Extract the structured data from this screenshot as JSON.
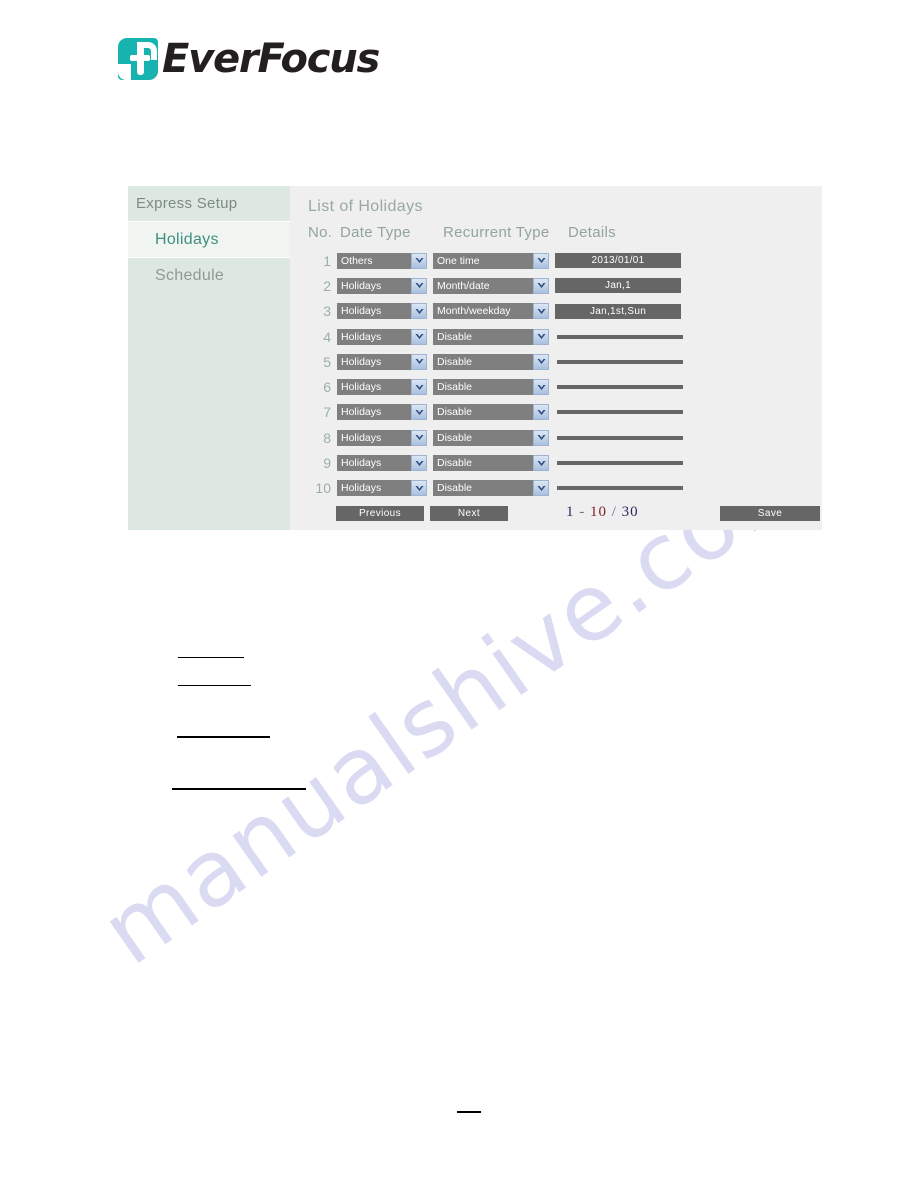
{
  "brand": {
    "name": "EverFocus",
    "logo_icon": "everfocus-f-logo-icon",
    "accent_color": "#16b3b0"
  },
  "watermark": {
    "text": "manualshive.com",
    "color": "#ccccef"
  },
  "panel": {
    "sidebar": {
      "title": "Express Setup",
      "items": [
        {
          "label": "Holidays",
          "active": true
        },
        {
          "label": "Schedule",
          "active": false
        }
      ],
      "background_color": "#dde8e0",
      "active_color": "#3f8f7e"
    },
    "content": {
      "list_title": "List of Holidays",
      "columns": {
        "no": "No.",
        "date_type": "Date Type",
        "recurrent_type": "Recurrent Type",
        "details": "Details"
      },
      "rows": [
        {
          "no": "1",
          "date_type": "Others",
          "recurrent_type": "One time",
          "details": "2013/01/01",
          "details_enabled": true
        },
        {
          "no": "2",
          "date_type": "Holidays",
          "recurrent_type": "Month/date",
          "details": "Jan,1",
          "details_enabled": true
        },
        {
          "no": "3",
          "date_type": "Holidays",
          "recurrent_type": "Month/weekday",
          "details": "Jan,1st,Sun",
          "details_enabled": true
        },
        {
          "no": "4",
          "date_type": "Holidays",
          "recurrent_type": "Disable",
          "details": "",
          "details_enabled": false
        },
        {
          "no": "5",
          "date_type": "Holidays",
          "recurrent_type": "Disable",
          "details": "",
          "details_enabled": false
        },
        {
          "no": "6",
          "date_type": "Holidays",
          "recurrent_type": "Disable",
          "details": "",
          "details_enabled": false
        },
        {
          "no": "7",
          "date_type": "Holidays",
          "recurrent_type": "Disable",
          "details": "",
          "details_enabled": false
        },
        {
          "no": "8",
          "date_type": "Holidays",
          "recurrent_type": "Disable",
          "details": "",
          "details_enabled": false
        },
        {
          "no": "9",
          "date_type": "Holidays",
          "recurrent_type": "Disable",
          "details": "",
          "details_enabled": false
        },
        {
          "no": "10",
          "date_type": "Holidays",
          "recurrent_type": "Disable",
          "details": "",
          "details_enabled": false
        }
      ],
      "footer": {
        "previous_label": "Previous",
        "next_label": "Next",
        "save_label": "Save",
        "pager": {
          "from": "1",
          "dash": "-",
          "to": "10",
          "slash": "/",
          "total": "30",
          "highlight_color": "#7a1f2b"
        }
      }
    }
  }
}
